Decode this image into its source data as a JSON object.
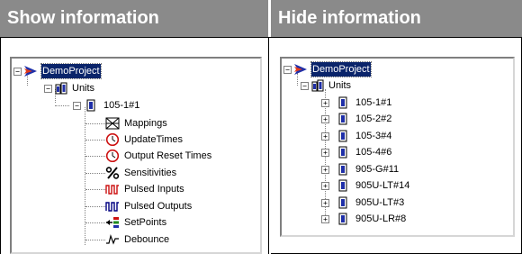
{
  "headers": {
    "left": "Show information",
    "right": "Hide information"
  },
  "show_tree": {
    "root": "DemoProject",
    "units": "Units",
    "unit": "105-1#1",
    "children": [
      {
        "label": "Mappings",
        "icon": "mappings-icon"
      },
      {
        "label": "UpdateTimes",
        "icon": "clock-icon"
      },
      {
        "label": "Output Reset Times",
        "icon": "clock-icon"
      },
      {
        "label": "Sensitivities",
        "icon": "percent-icon"
      },
      {
        "label": "Pulsed Inputs",
        "icon": "pulsed-inputs-icon"
      },
      {
        "label": "Pulsed Outputs",
        "icon": "pulsed-outputs-icon"
      },
      {
        "label": "SetPoints",
        "icon": "setpoints-icon"
      },
      {
        "label": "Debounce",
        "icon": "debounce-icon"
      }
    ]
  },
  "hide_tree": {
    "root": "DemoProject",
    "units": "Units",
    "units_list": [
      "105-1#1",
      "105-2#2",
      "105-3#4",
      "105-4#6",
      "905-G#11",
      "905U-LT#14",
      "905U-LT#3",
      "905U-LR#8"
    ]
  },
  "colors": {
    "header_bg": "#8a8a8a",
    "selection": "#0a246a",
    "unit_icon": "#1f2fa8",
    "clock": "#cc1010"
  }
}
